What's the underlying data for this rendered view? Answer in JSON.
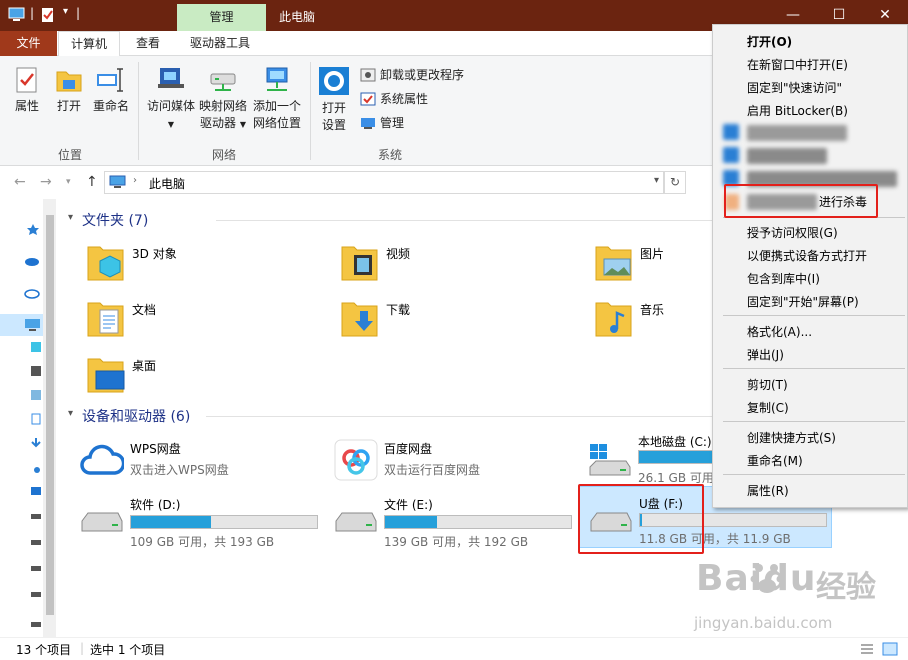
{
  "window": {
    "title": "此电脑",
    "context_tab": "管理",
    "controls": {
      "minimize": "—",
      "maximize": "☐",
      "close": "✕"
    }
  },
  "ribbon_tabs": {
    "file": "文件",
    "computer": "计算机",
    "view": "查看",
    "drive_tools": "驱动器工具"
  },
  "ribbon": {
    "location": {
      "label": "位置",
      "properties": "属性",
      "open": "打开",
      "rename": "重命名"
    },
    "network": {
      "label": "网络",
      "access_media": "访问媒体",
      "map_drive_1": "映射网络",
      "map_drive_2": "驱动器",
      "add_location_1": "添加一个",
      "add_location_2": "网络位置"
    },
    "system": {
      "label": "系统",
      "open_settings_1": "打开",
      "open_settings_2": "设置",
      "uninstall": "卸载或更改程序",
      "system_props": "系统属性",
      "manage": "管理"
    }
  },
  "address": {
    "path": "此电脑",
    "back": "←",
    "forward": "→",
    "up": "↑",
    "refresh": "↻"
  },
  "folders": {
    "header": "文件夹 (7)",
    "items": [
      {
        "name": "3D 对象"
      },
      {
        "name": "视频"
      },
      {
        "name": "图片"
      },
      {
        "name": "文档"
      },
      {
        "name": "下载"
      },
      {
        "name": "音乐"
      },
      {
        "name": "桌面"
      }
    ]
  },
  "devices": {
    "header": "设备和驱动器 (6)",
    "wps": {
      "name": "WPS网盘",
      "sub": "双击进入WPS网盘"
    },
    "baidu": {
      "name": "百度网盘",
      "sub": "双击运行百度网盘"
    },
    "local_c": {
      "name": "本地磁盘 (C:)",
      "free": "26.1 GB 可用,",
      "used_fraction": 0.86
    },
    "drive_d": {
      "name": "软件 (D:)",
      "free": "109 GB 可用，共 193 GB",
      "used_fraction": 0.43
    },
    "drive_e": {
      "name": "文件 (E:)",
      "free": "139 GB 可用，共 192 GB",
      "used_fraction": 0.28
    },
    "drive_f": {
      "name": "U盘 (F:)",
      "free": "11.8 GB 可用，共 11.9 GB",
      "used_fraction": 0.01
    }
  },
  "status": {
    "count": "13 个项目",
    "selected": "选中 1 个项目"
  },
  "context_menu": {
    "open": "打开(O)",
    "open_new_window": "在新窗口中打开(E)",
    "pin_quick_access": "固定到\"快速访问\"",
    "bitlocker": "启用 BitLocker(B)",
    "scan_virus": "进行杀毒",
    "grant_access": "授予访问权限(G)",
    "open_portable": "以便携式设备方式打开",
    "include_library": "包含到库中(I)",
    "pin_start": "固定到\"开始\"屏幕(P)",
    "format": "格式化(A)...",
    "eject": "弹出(J)",
    "cut": "剪切(T)",
    "copy": "复制(C)",
    "create_shortcut": "创建快捷方式(S)",
    "rename": "重命名(M)",
    "properties": "属性(R)"
  },
  "watermark": {
    "brand": "Baidu",
    "brand_cn": "经验",
    "url": "jingyan.baidu.com"
  },
  "colors": {
    "titlebar": "#6b2410",
    "file_tab": "#a0391b",
    "context_tab": "#c9ebc3",
    "accent": "#26a0da",
    "highlight": "#e3201b"
  }
}
